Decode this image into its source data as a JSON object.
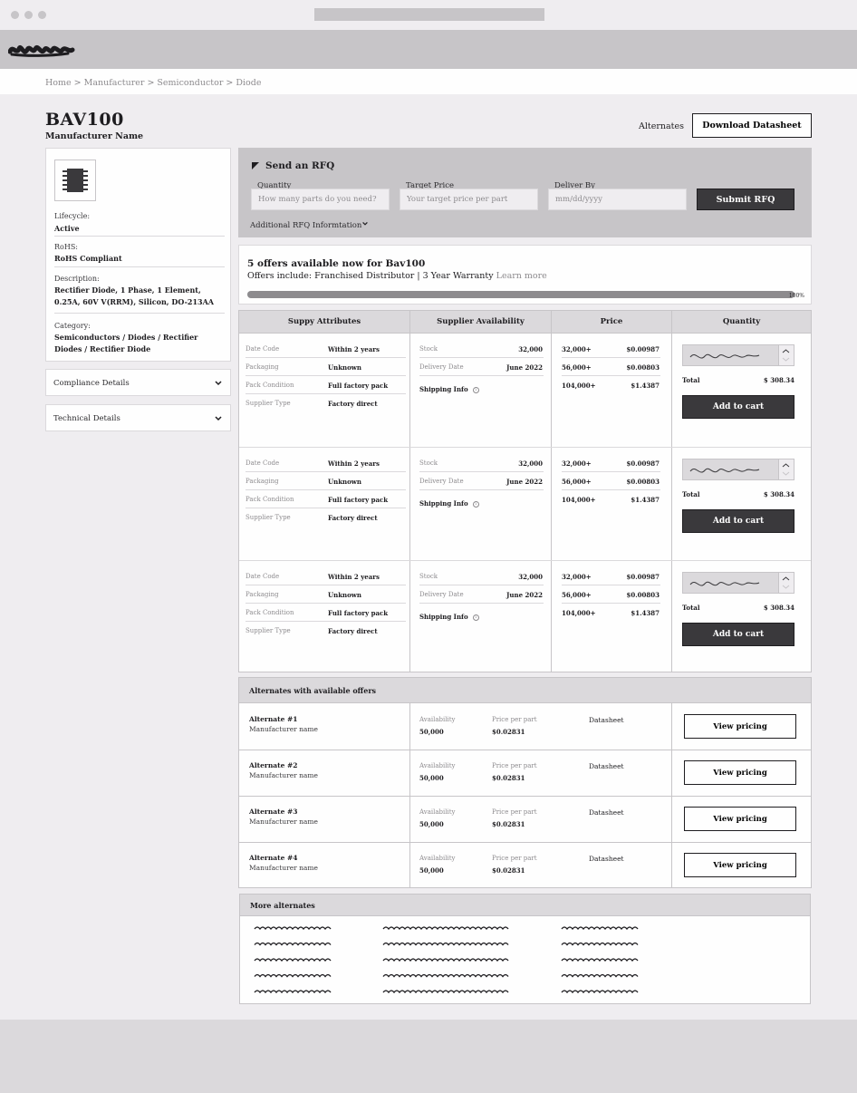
{
  "breadcrumb": [
    "Home",
    "Manufacturer",
    "Semiconductor",
    "Diode"
  ],
  "breadcrumb_sep": " > ",
  "product": {
    "title": "BAV100",
    "manufacturer": "Manufacturer Name"
  },
  "header_actions": {
    "alternates": "Alternates",
    "download": "Download Datasheet"
  },
  "specs": {
    "lifecycle_label": "Lifecycle:",
    "lifecycle_value": "Active",
    "rohs_label": "RoHS:",
    "rohs_value": "RoHS Compliant",
    "description_label": "Description:",
    "description_value": "Rectifier Diode, 1 Phase, 1 Element, 0.25A, 60V V(RRM), Silicon, DO-213AA",
    "category_label": "Category:",
    "category_value": "Semiconductors / Diodes / Rectifier Diodes / Rectifier Diode"
  },
  "accordions": [
    "Compliance Details",
    "Technical Details"
  ],
  "rfq": {
    "title": "Send an RFQ",
    "quantity_label": "Quantity",
    "quantity_placeholder": "How many parts do you need?",
    "price_label": "Target Price",
    "price_placeholder": "Your target price per part",
    "deliver_label": "Deliver By",
    "deliver_placeholder": "mm/dd/yyyy",
    "submit": "Submit RFQ",
    "additional": "Additional RFQ Informtation"
  },
  "offers": {
    "headline": "5 offers available now for Bav100",
    "includes": "Offers include: Franchised Distributor |  3 Year Warranty",
    "learn_more": "Learn more",
    "progress": 100,
    "progress_label": "100%"
  },
  "grid_headers": [
    "Suppy Attributes",
    "Supplier Availability",
    "Price",
    "Quantity"
  ],
  "offer_rows": [
    {
      "attributes": [
        {
          "label": "Date Code",
          "value": "Within 2 years"
        },
        {
          "label": "Packaging",
          "value": "Unknown"
        },
        {
          "label": "Pack Condition",
          "value": "Full factory pack"
        },
        {
          "label": "Supplier Type",
          "value": "Factory direct"
        }
      ],
      "stock_label": "Stock",
      "stock": "32,000",
      "delivery_label": "Delivery Date",
      "delivery": "June 2022",
      "shipping": "Shipping Info",
      "prices": [
        {
          "qty": "32,000+",
          "price": "$0.00987"
        },
        {
          "qty": "56,000+",
          "price": "$0.00803"
        },
        {
          "qty": "104,000+",
          "price": "$1.4387"
        }
      ],
      "total_label": "Total",
      "total": "$ 308.34",
      "cart": "Add to cart"
    },
    {
      "attributes": [
        {
          "label": "Date Code",
          "value": "Within 2 years"
        },
        {
          "label": "Packaging",
          "value": "Unknown"
        },
        {
          "label": "Pack Condition",
          "value": "Full factory pack"
        },
        {
          "label": "Supplier Type",
          "value": "Factory direct"
        }
      ],
      "stock_label": "Stock",
      "stock": "32,000",
      "delivery_label": "Delivery Date",
      "delivery": "June 2022",
      "shipping": "Shipping Info",
      "prices": [
        {
          "qty": "32,000+",
          "price": "$0.00987"
        },
        {
          "qty": "56,000+",
          "price": "$0.00803"
        },
        {
          "qty": "104,000+",
          "price": "$1.4387"
        }
      ],
      "total_label": "Total",
      "total": "$ 308.34",
      "cart": "Add to cart"
    },
    {
      "attributes": [
        {
          "label": "Date Code",
          "value": "Within 2 years"
        },
        {
          "label": "Packaging",
          "value": "Unknown"
        },
        {
          "label": "Pack Condition",
          "value": "Full factory pack"
        },
        {
          "label": "Supplier Type",
          "value": "Factory direct"
        }
      ],
      "stock_label": "Stock",
      "stock": "32,000",
      "delivery_label": "Delivery Date",
      "delivery": "June 2022",
      "shipping": "Shipping Info",
      "prices": [
        {
          "qty": "32,000+",
          "price": "$0.00987"
        },
        {
          "qty": "56,000+",
          "price": "$0.00803"
        },
        {
          "qty": "104,000+",
          "price": "$1.4387"
        }
      ],
      "total_label": "Total",
      "total": "$ 308.34",
      "cart": "Add to cart"
    }
  ],
  "alternates_section": {
    "title": "Alternates with available offers",
    "availability_label": "Availability",
    "price_label": "Price per part",
    "datasheet": "Datasheet",
    "view_pricing": "View pricing",
    "items": [
      {
        "name": "Alternate #1",
        "mfr": "Manufacturer name",
        "availability": "50,000",
        "price": "$0.02831"
      },
      {
        "name": "Alternate #2",
        "mfr": "Manufacturer name",
        "availability": "50,000",
        "price": "$0.02831"
      },
      {
        "name": "Alternate #3",
        "mfr": "Manufacturer name",
        "availability": "50,000",
        "price": "$0.02831"
      },
      {
        "name": "Alternate #4",
        "mfr": "Manufacturer name",
        "availability": "50,000",
        "price": "$0.02831"
      }
    ]
  },
  "more_alternates": {
    "title": "More alternates"
  }
}
